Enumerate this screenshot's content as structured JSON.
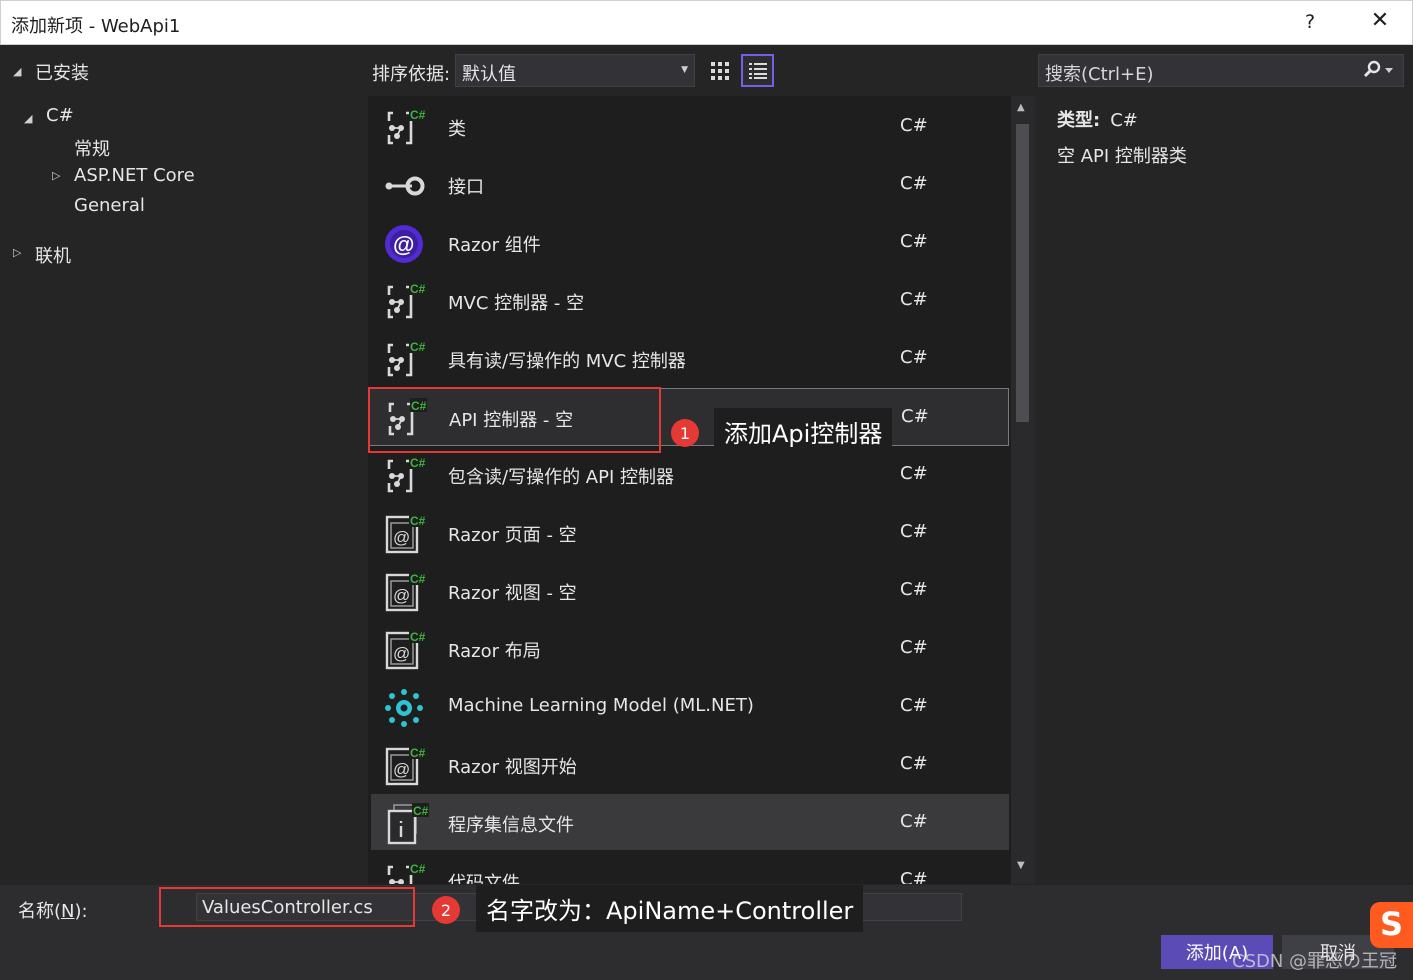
{
  "window": {
    "title": "添加新项 - WebApi1",
    "help": "?",
    "close": "✕"
  },
  "tree": {
    "installed": "已安装",
    "csharp": "C#",
    "general_cn": "常规",
    "aspnet": "ASP.NET Core",
    "general": "General",
    "online": "联机"
  },
  "toolbar": {
    "sort_label": "排序依据:",
    "sort_value": "默认值",
    "search_placeholder": "搜索(Ctrl+E)"
  },
  "items": [
    {
      "name": "类",
      "lang": "C#",
      "icon": "template-icon"
    },
    {
      "name": "接口",
      "lang": "C#",
      "icon": "interface-icon"
    },
    {
      "name": "Razor 组件",
      "lang": "C#",
      "icon": "razor-component-icon"
    },
    {
      "name": "MVC 控制器 - 空",
      "lang": "C#",
      "icon": "template-icon"
    },
    {
      "name": "具有读/写操作的 MVC 控制器",
      "lang": "C#",
      "icon": "template-icon"
    },
    {
      "name": "API 控制器 - 空",
      "lang": "C#",
      "icon": "template-icon"
    },
    {
      "name": "包含读/写操作的 API 控制器",
      "lang": "C#",
      "icon": "template-icon"
    },
    {
      "name": "Razor 页面 - 空",
      "lang": "C#",
      "icon": "razor-page-icon"
    },
    {
      "name": "Razor 视图 - 空",
      "lang": "C#",
      "icon": "razor-page-icon"
    },
    {
      "name": "Razor 布局",
      "lang": "C#",
      "icon": "razor-page-icon"
    },
    {
      "name": "Machine Learning Model (ML.NET)",
      "lang": "C#",
      "icon": "ml-model-icon"
    },
    {
      "name": "Razor 视图开始",
      "lang": "C#",
      "icon": "razor-page-icon"
    },
    {
      "name": "程序集信息文件",
      "lang": "C#",
      "icon": "assembly-info-icon"
    },
    {
      "name": "代码文件",
      "lang": "C#",
      "icon": "template-icon"
    }
  ],
  "details": {
    "type_label": "类型:",
    "type_value": "C#",
    "description": "空 API 控制器类"
  },
  "bottom": {
    "name_label_pre": "名称(",
    "name_label_key": "N",
    "name_label_post": "):",
    "name_value": "ValuesController.cs",
    "add_label": "添加(A)",
    "cancel_label": "取消"
  },
  "annotations": {
    "badge1": "1",
    "callout1": "添加Api控制器",
    "badge2": "2",
    "callout2": "名字改为：ApiName+Controller"
  },
  "watermark": "CSDN @罪恶の王冠",
  "sogou": "S",
  "colors": {
    "accent": "#7460e6",
    "highlight": "#e53935",
    "csharp_badge": "#3cb53c",
    "ml_icon": "#2ec5d3",
    "razor": "#512bd4"
  }
}
